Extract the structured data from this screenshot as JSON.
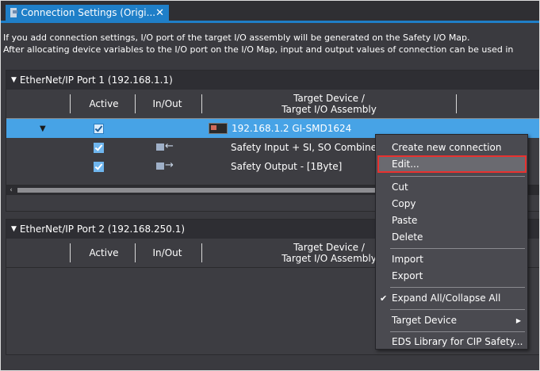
{
  "tab": {
    "label": "Connection Settings (Origi...",
    "close": "✕"
  },
  "info": {
    "line1": "If you add connection settings, I/O port of the target I/O assembly will be generated on the Safety I/O Map.",
    "line2": "After allocating device variables to the I/O port on the I/O Map, input and output values of connection can be used in"
  },
  "port1": {
    "title": "EtherNet/IP Port 1 (192.168.1.1)",
    "columns": {
      "active": "Active",
      "inout": "In/Out",
      "target_line1": "Target Device /",
      "target_line2": "Target I/O Assembly"
    },
    "rows": [
      {
        "expand": "▼",
        "active": true,
        "target": "192.168.1.2 GI-SMD1624",
        "selected": true
      },
      {
        "active": true,
        "inout": "in",
        "target": "Safety Input + SI, SO Combined"
      },
      {
        "active": true,
        "inout": "out",
        "target": "Safety Output - [1Byte]"
      }
    ]
  },
  "port2": {
    "title": "EtherNet/IP Port 2 (192.168.250.1)",
    "columns": {
      "active": "Active",
      "inout": "In/Out",
      "target_line1": "Target Device /",
      "target_line2": "Target I/O Assembly"
    }
  },
  "context_menu": {
    "items": {
      "create": "Create new connection",
      "edit": "Edit...",
      "cut": "Cut",
      "copy": "Copy",
      "paste": "Paste",
      "delete": "Delete",
      "import": "Import",
      "export": "Export",
      "expand": "Expand All/Collapse All",
      "target_device": "Target Device",
      "eds": "EDS Library for CIP Safety..."
    },
    "expand_checked": true,
    "highlight_color": "#e8312f"
  },
  "colors": {
    "accent": "#1f7fc8",
    "selected_row": "#47a3e6",
    "background": "#3a3a3f"
  }
}
